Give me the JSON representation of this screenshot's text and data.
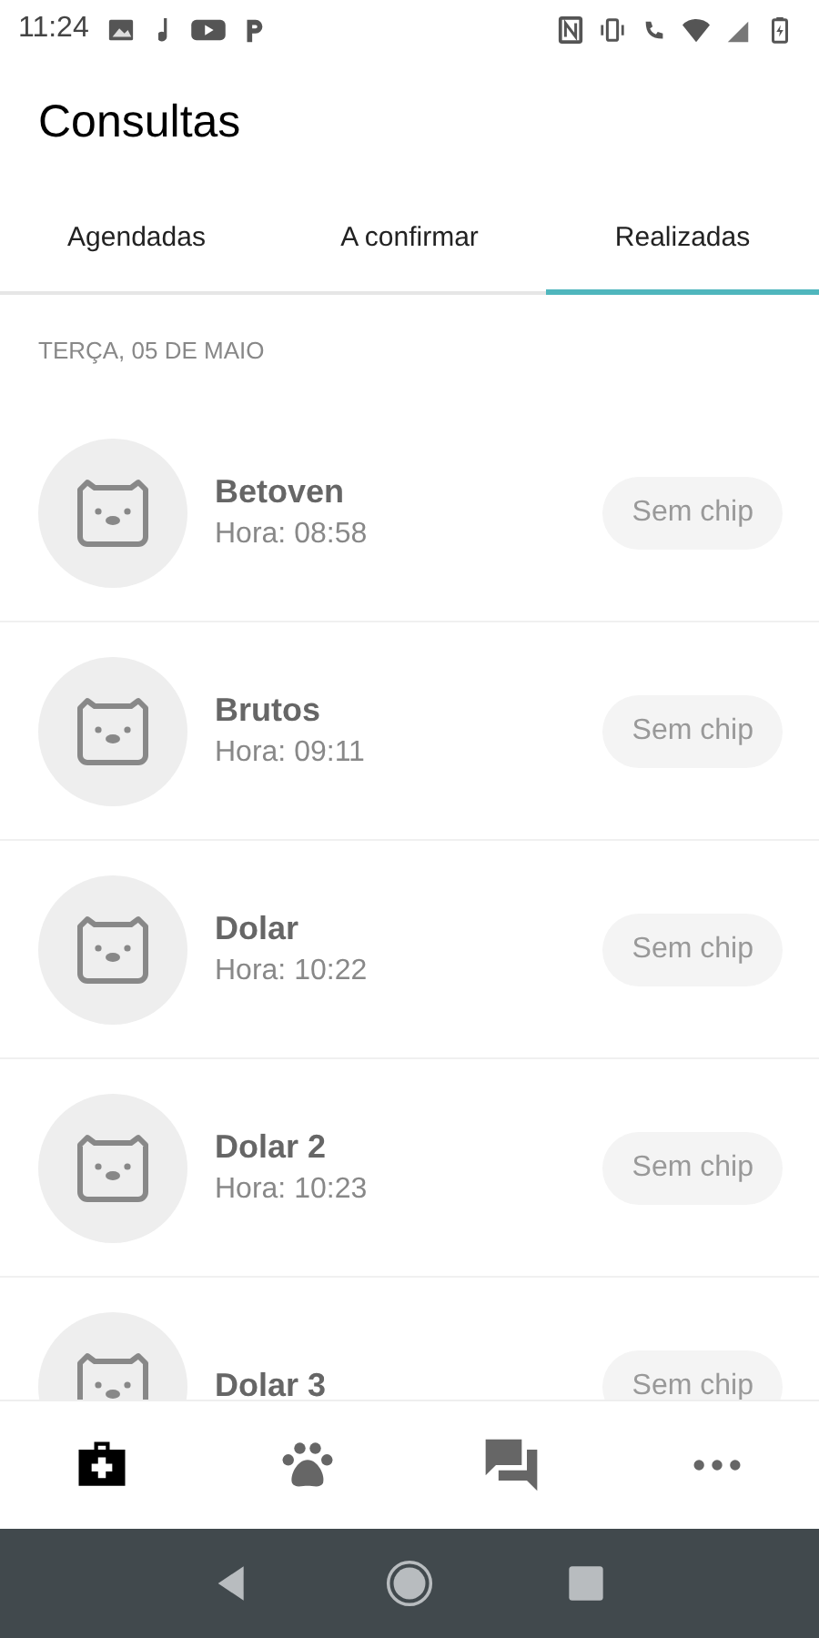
{
  "status_bar": {
    "time": "11:24"
  },
  "title": "Consultas",
  "tabs": [
    {
      "label": "Agendadas",
      "selected": false
    },
    {
      "label": "A confirmar",
      "selected": false
    },
    {
      "label": "Realizadas",
      "selected": true
    }
  ],
  "date_header": "TERÇA, 05 DE MAIO",
  "appointments": [
    {
      "name": "Betoven",
      "time": "Hora: 08:58",
      "chip": "Sem chip"
    },
    {
      "name": "Brutos",
      "time": "Hora: 09:11",
      "chip": "Sem chip"
    },
    {
      "name": "Dolar",
      "time": "Hora: 10:22",
      "chip": "Sem chip"
    },
    {
      "name": "Dolar 2",
      "time": "Hora: 10:23",
      "chip": "Sem chip"
    },
    {
      "name": "Dolar 3",
      "chip": "Sem chip"
    }
  ],
  "bottom_nav": [
    {
      "kind": "medkit",
      "selected": true
    },
    {
      "kind": "paw",
      "selected": false
    },
    {
      "kind": "chat",
      "selected": false
    },
    {
      "kind": "more",
      "selected": false
    }
  ]
}
